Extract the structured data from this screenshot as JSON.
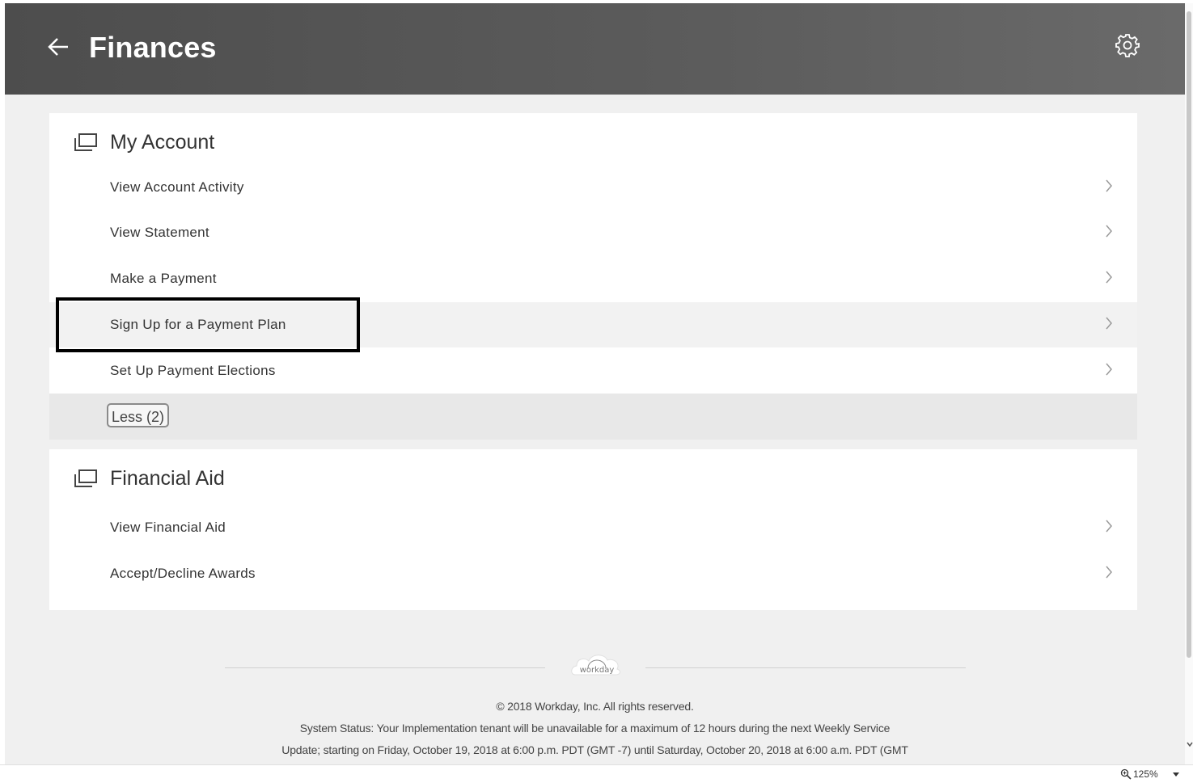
{
  "header": {
    "title": "Finances",
    "back_icon": "arrow-left-icon",
    "settings_icon": "gear-icon"
  },
  "sections": [
    {
      "title": "My Account",
      "icon": "window-stack-icon",
      "items": [
        {
          "label": "View Account Activity"
        },
        {
          "label": "View Statement"
        },
        {
          "label": "Make a Payment"
        },
        {
          "label": "Sign Up for a Payment Plan"
        },
        {
          "label": "Set Up Payment Elections"
        }
      ],
      "toggle_label": "Less (2)"
    },
    {
      "title": "Financial Aid",
      "icon": "window-stack-icon",
      "items": [
        {
          "label": "View Financial Aid"
        },
        {
          "label": "Accept/Decline Awards"
        }
      ]
    }
  ],
  "footer": {
    "logo_text": "workday",
    "copyright": "© 2018 Workday, Inc. All rights reserved.",
    "status_line1": "System Status: Your Implementation tenant will be unavailable for a maximum of 12 hours during the next Weekly Service",
    "status_line2": "Update; starting on Friday, October 19, 2018 at 6:00 p.m. PDT (GMT -7) until Saturday, October 20, 2018 at 6:00 a.m. PDT (GMT"
  },
  "statusbar": {
    "zoom": "125%"
  },
  "colors": {
    "header_bg": "#555555",
    "page_bg": "#f0f0f0",
    "card_bg": "#ffffff",
    "highlight_border": "#000000"
  }
}
